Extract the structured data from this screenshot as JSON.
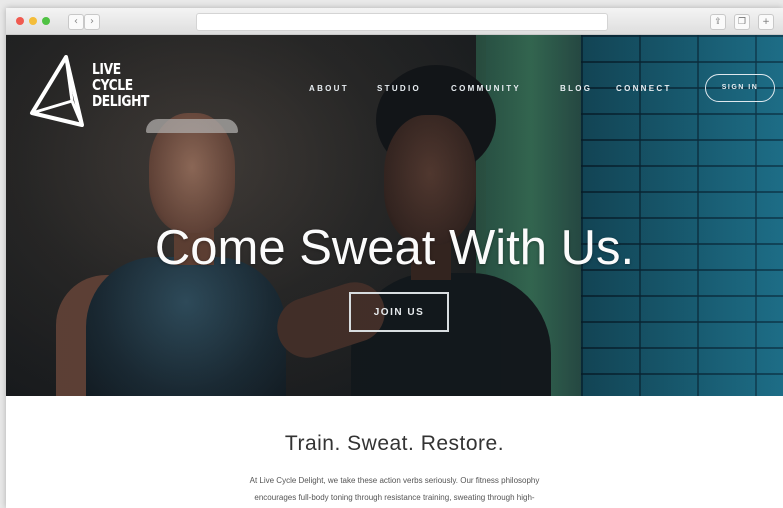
{
  "browser": {
    "back_glyph": "‹",
    "forward_glyph": "›",
    "share_glyph": "⇪",
    "tabs_glyph": "❐",
    "newtab_glyph": "+"
  },
  "site": {
    "logo": {
      "lines": [
        "LIVE",
        "CYCLE",
        "DELIGHT"
      ]
    },
    "nav": {
      "about": "ABOUT",
      "studio": "STUDIO",
      "community": "COMMUNITY",
      "blog": "BLOG",
      "connect": "CONNECT",
      "sign_in": "SIGN IN"
    },
    "hero": {
      "headline": "Come Sweat With Us.",
      "cta": "JOIN US"
    },
    "intro": {
      "title": "Train. Sweat. Restore.",
      "paragraph_line1": "At Live Cycle Delight, we take these action verbs seriously. Our fitness philosophy",
      "paragraph_line2": "encourages full-body toning through resistance training, sweating through high-"
    }
  },
  "colors": {
    "accent_teal": "#1f6f86",
    "text_dark": "#333333",
    "hero_text": "#fbfbfb"
  }
}
